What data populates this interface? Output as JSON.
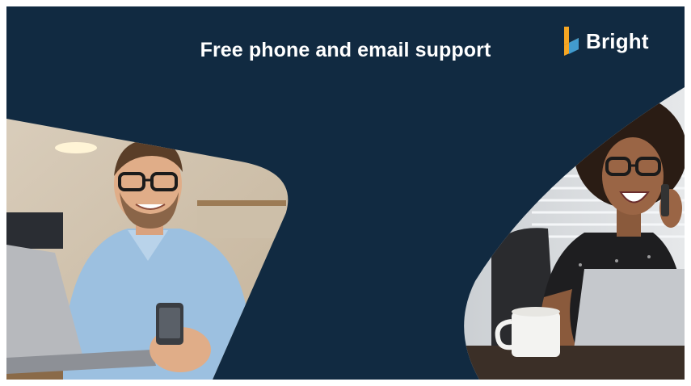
{
  "slide": {
    "title": "Free phone and email support",
    "background_color": "#112a41"
  },
  "logo": {
    "text": "Bright",
    "icon": "bright-logo-icon",
    "colors": [
      "#f5a623",
      "#2f9ae0"
    ]
  },
  "photos": {
    "left": "man-with-phone-and-laptop-photo",
    "right": "woman-on-phone-with-laptop-photo"
  }
}
